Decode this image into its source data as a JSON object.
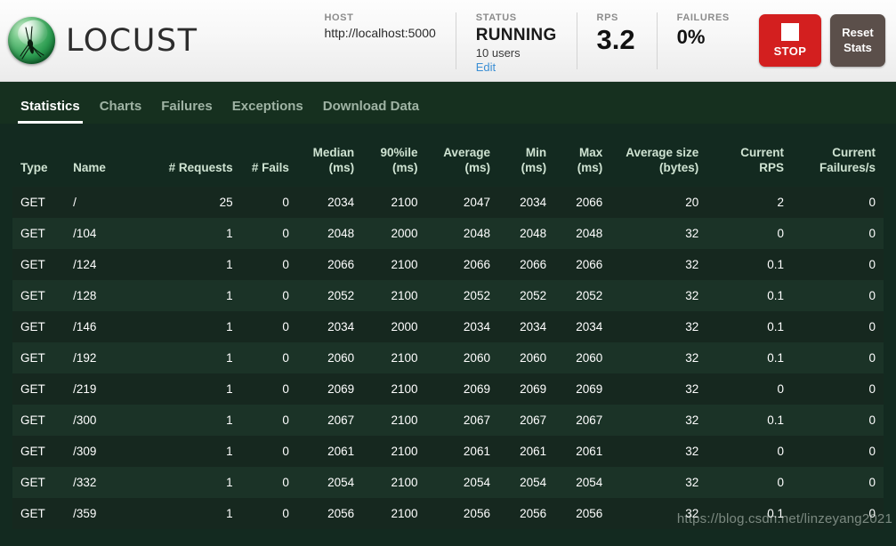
{
  "header": {
    "logo_text": "LOCUST",
    "logo_icon": "locust-logo-icon",
    "host": {
      "label": "HOST",
      "value": "http://localhost:5000"
    },
    "status": {
      "label": "STATUS",
      "value": "RUNNING",
      "users": "10 users",
      "edit_link": "Edit"
    },
    "rps": {
      "label": "RPS",
      "value": "3.2"
    },
    "failures": {
      "label": "FAILURES",
      "value": "0%"
    },
    "stop_button": {
      "label": "STOP",
      "icon": "stop-square-icon",
      "color": "#d31f1f"
    },
    "reset_button": {
      "label": "Reset Stats",
      "color": "#5b4f4a"
    }
  },
  "tabs": [
    {
      "label": "Statistics",
      "active": true
    },
    {
      "label": "Charts",
      "active": false
    },
    {
      "label": "Failures",
      "active": false
    },
    {
      "label": "Exceptions",
      "active": false
    },
    {
      "label": "Download Data",
      "active": false
    }
  ],
  "table": {
    "columns": [
      "Type",
      "Name",
      "# Requests",
      "# Fails",
      "Median\n(ms)",
      "90%ile\n(ms)",
      "Average\n(ms)",
      "Min\n(ms)",
      "Max\n(ms)",
      "Average size\n(bytes)",
      "Current\nRPS",
      "Current\nFailures/s"
    ],
    "rows": [
      {
        "type": "GET",
        "name": "/",
        "requests": "25",
        "fails": "0",
        "median": "2034",
        "p90": "2100",
        "average": "2047",
        "min": "2034",
        "max": "2066",
        "avg_size": "20",
        "current_rps": "2",
        "current_failures": "0"
      },
      {
        "type": "GET",
        "name": "/104",
        "requests": "1",
        "fails": "0",
        "median": "2048",
        "p90": "2000",
        "average": "2048",
        "min": "2048",
        "max": "2048",
        "avg_size": "32",
        "current_rps": "0",
        "current_failures": "0"
      },
      {
        "type": "GET",
        "name": "/124",
        "requests": "1",
        "fails": "0",
        "median": "2066",
        "p90": "2100",
        "average": "2066",
        "min": "2066",
        "max": "2066",
        "avg_size": "32",
        "current_rps": "0.1",
        "current_failures": "0"
      },
      {
        "type": "GET",
        "name": "/128",
        "requests": "1",
        "fails": "0",
        "median": "2052",
        "p90": "2100",
        "average": "2052",
        "min": "2052",
        "max": "2052",
        "avg_size": "32",
        "current_rps": "0.1",
        "current_failures": "0"
      },
      {
        "type": "GET",
        "name": "/146",
        "requests": "1",
        "fails": "0",
        "median": "2034",
        "p90": "2000",
        "average": "2034",
        "min": "2034",
        "max": "2034",
        "avg_size": "32",
        "current_rps": "0.1",
        "current_failures": "0"
      },
      {
        "type": "GET",
        "name": "/192",
        "requests": "1",
        "fails": "0",
        "median": "2060",
        "p90": "2100",
        "average": "2060",
        "min": "2060",
        "max": "2060",
        "avg_size": "32",
        "current_rps": "0.1",
        "current_failures": "0"
      },
      {
        "type": "GET",
        "name": "/219",
        "requests": "1",
        "fails": "0",
        "median": "2069",
        "p90": "2100",
        "average": "2069",
        "min": "2069",
        "max": "2069",
        "avg_size": "32",
        "current_rps": "0",
        "current_failures": "0"
      },
      {
        "type": "GET",
        "name": "/300",
        "requests": "1",
        "fails": "0",
        "median": "2067",
        "p90": "2100",
        "average": "2067",
        "min": "2067",
        "max": "2067",
        "avg_size": "32",
        "current_rps": "0.1",
        "current_failures": "0"
      },
      {
        "type": "GET",
        "name": "/309",
        "requests": "1",
        "fails": "0",
        "median": "2061",
        "p90": "2100",
        "average": "2061",
        "min": "2061",
        "max": "2061",
        "avg_size": "32",
        "current_rps": "0",
        "current_failures": "0"
      },
      {
        "type": "GET",
        "name": "/332",
        "requests": "1",
        "fails": "0",
        "median": "2054",
        "p90": "2100",
        "average": "2054",
        "min": "2054",
        "max": "2054",
        "avg_size": "32",
        "current_rps": "0",
        "current_failures": "0"
      },
      {
        "type": "GET",
        "name": "/359",
        "requests": "1",
        "fails": "0",
        "median": "2056",
        "p90": "2100",
        "average": "2056",
        "min": "2056",
        "max": "2056",
        "avg_size": "32",
        "current_rps": "0.1",
        "current_failures": "0"
      }
    ]
  },
  "watermark": "https://blog.csdn.net/linzeyang2021"
}
